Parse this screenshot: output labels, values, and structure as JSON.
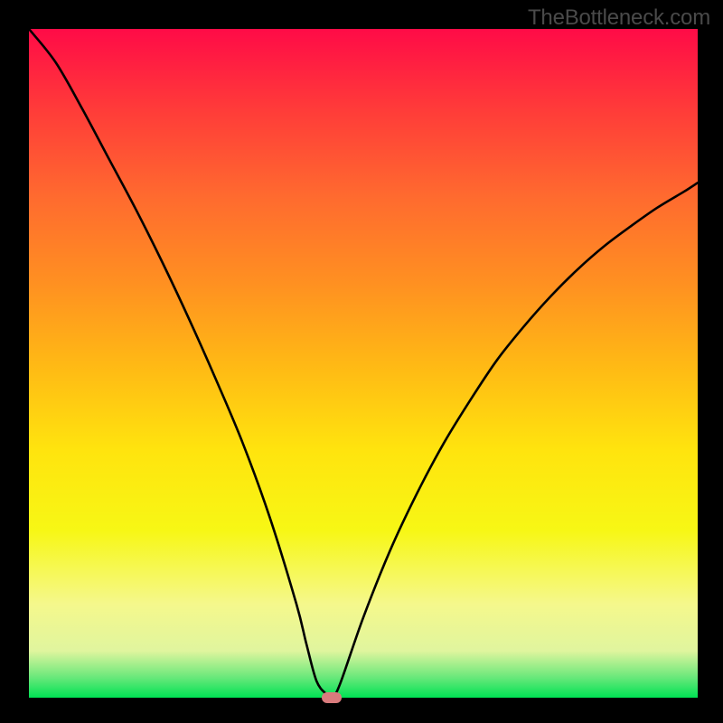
{
  "watermark": "TheBottleneck.com",
  "chart_data": {
    "type": "line",
    "title": "",
    "xlabel": "",
    "ylabel": "",
    "xlim": [
      0,
      100
    ],
    "ylim": [
      0,
      100
    ],
    "series": [
      {
        "name": "bottleneck-curve",
        "x": [
          0,
          4,
          8,
          12,
          16,
          20,
          24,
          28,
          32,
          36,
          40,
          41.5,
          43,
          44.5,
          45.3,
          46.5,
          50,
          54,
          58,
          62,
          66,
          70,
          74,
          78,
          82,
          86,
          90,
          94,
          98,
          100
        ],
        "values": [
          100,
          95,
          88,
          80.5,
          73,
          65,
          56.5,
          47.5,
          38,
          27,
          14,
          8,
          2.5,
          0.5,
          0,
          2,
          12,
          22,
          30.5,
          38,
          44.5,
          50.5,
          55.5,
          60,
          64,
          67.5,
          70.5,
          73.3,
          75.7,
          77
        ]
      }
    ],
    "marker": {
      "x": 45.3,
      "y": 0,
      "color": "#d97b7d"
    },
    "background_gradient": {
      "top": "#ff0b47",
      "bottom": "#00e254"
    }
  }
}
